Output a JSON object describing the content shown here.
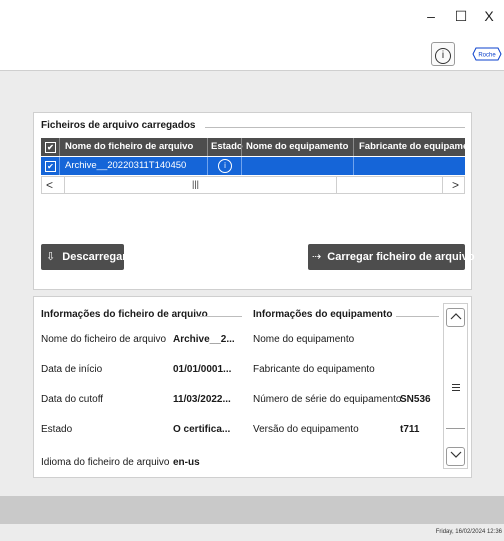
{
  "window": {
    "minimize": "–",
    "maximize": "☐",
    "close": "X"
  },
  "toolbar": {
    "info_symbol": "i",
    "logo_text": "Roche"
  },
  "files_panel": {
    "title": "Ficheiros de arquivo carregados",
    "columns": [
      "Nome do ficheiro de arquivo",
      "Estado",
      "Nome do equipamento",
      "Fabricante do equipamen"
    ],
    "rows": [
      {
        "checked": true,
        "name": "Archive__20220311T140450",
        "status_icon": "info-icon",
        "equipment": "",
        "manufacturer": ""
      }
    ],
    "scroll_grip": "|||"
  },
  "actions": {
    "download_label": "Descarregar",
    "download_symbol": "⇩",
    "upload_label": "Carregar ficheiro de arquivo",
    "upload_symbol": "⇢"
  },
  "file_info": {
    "title": "Informações do ficheiro de arquivo",
    "fields": [
      {
        "label": "Nome do ficheiro de arquivo",
        "value": "Archive__2..."
      },
      {
        "label": "Data de início",
        "value": "01/01/0001..."
      },
      {
        "label": "Data do cutoff",
        "value": "11/03/2022..."
      },
      {
        "label": "Estado",
        "value": "O certifica..."
      },
      {
        "label": "Idioma do ficheiro de arquivo",
        "value": "en-us"
      }
    ]
  },
  "equipment_info": {
    "title": "Informações do equipamento",
    "fields": [
      {
        "label": "Nome do equipamento",
        "value": ""
      },
      {
        "label": "Fabricante do equipamento",
        "value": ""
      },
      {
        "label": "Número de série do equipamento",
        "value": "SN536"
      },
      {
        "label": "Versão do equipamento",
        "value": "t711"
      }
    ]
  },
  "status": {
    "datetime": "Friday, 16/02/2024 12:36"
  },
  "colors": {
    "accent": "#1565d8",
    "header": "#4d4d4d",
    "background": "#ececec"
  }
}
